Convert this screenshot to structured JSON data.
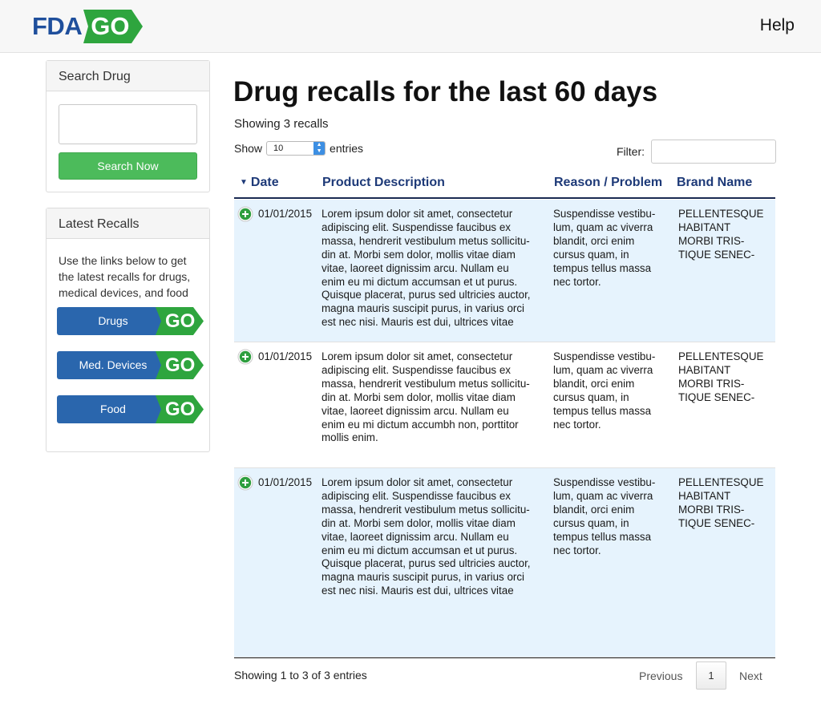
{
  "header": {
    "logo_fda": "FDA",
    "logo_go": "GO",
    "help_label": "Help",
    "brand_blue": "#1f4f9c",
    "brand_green": "#2ea53e"
  },
  "sidebar": {
    "search": {
      "title": "Search Drug",
      "input_value": "",
      "button_label": "Search Now"
    },
    "latest": {
      "title": "Latest Recalls",
      "intro": "Use the links below to get the latest recalls for drugs, medical devices, and food",
      "go_label": "GO",
      "links": [
        {
          "label": "Drugs"
        },
        {
          "label": "Med. Devices"
        },
        {
          "label": "Food"
        }
      ]
    }
  },
  "main": {
    "title": "Drug recalls for the last 60 days",
    "count_text": "Showing 3 recalls",
    "length": {
      "prefix": "Show",
      "value": "10",
      "suffix": "entries"
    },
    "filter_label": "Filter:",
    "filter_value": "",
    "columns": {
      "date": "Date",
      "description": "Product Description",
      "reason": "Reason / Problem",
      "brand": "Brand Name"
    },
    "rows": [
      {
        "date": "01/01/2015",
        "description": [
          "Lorem ipsum dolor sit amet, consectetur",
          "adipiscing elit. Suspendisse faucibus ex",
          "massa, hendrerit vestibulum metus sollicitu-",
          "din at. Morbi sem dolor, mollis vitae diam",
          "vitae, laoreet dignissim arcu. Nullam eu",
          "enim eu mi dictum accumsan et ut purus.",
          "Quisque placerat, purus sed ultricies auctor,",
          "magna mauris suscipit purus, in varius orci",
          "est nec nisi. Mauris est dui, ultrices vitae"
        ],
        "reason": [
          "Suspendisse vestibu-",
          "lum, quam ac viverra",
          "blandit, orci enim",
          "cursus quam, in",
          "tempus tellus massa",
          "nec tortor."
        ],
        "brand": [
          "PELLENTESQUE",
          "HABITANT",
          "MORBI TRIS-",
          "TIQUE SENEC-"
        ]
      },
      {
        "date": "01/01/2015",
        "description": [
          "Lorem ipsum dolor sit amet, consectetur",
          "adipiscing elit. Suspendisse faucibus ex",
          "massa, hendrerit vestibulum metus sollicitu-",
          "din at. Morbi sem dolor, mollis vitae diam",
          "vitae, laoreet dignissim arcu. Nullam eu",
          "enim eu mi dictum accumbh non, porttitor",
          "mollis enim."
        ],
        "reason": [
          "Suspendisse vestibu-",
          "lum, quam ac viverra",
          "blandit, orci enim",
          "cursus quam, in",
          "tempus tellus massa",
          "nec tortor."
        ],
        "brand": [
          "PELLENTESQUE",
          "HABITANT",
          "MORBI TRIS-",
          "TIQUE SENEC-"
        ]
      },
      {
        "date": "01/01/2015",
        "description": [
          "Lorem ipsum dolor sit amet, consectetur",
          "adipiscing elit. Suspendisse faucibus ex",
          "massa, hendrerit vestibulum metus sollicitu-",
          "din at. Morbi sem dolor, mollis vitae diam",
          "vitae, laoreet dignissim arcu. Nullam eu",
          "enim eu mi dictum accumsan et ut purus.",
          "Quisque placerat, purus sed ultricies auctor,",
          "magna mauris suscipit purus, in varius orci",
          "est nec nisi. Mauris est dui, ultrices vitae"
        ],
        "reason": [
          "Suspendisse vestibu-",
          "lum, quam ac viverra",
          "blandit, orci enim",
          "cursus quam, in",
          "tempus tellus massa",
          "nec tortor."
        ],
        "brand": [
          "PELLENTESQUE",
          "HABITANT",
          "MORBI TRIS-",
          "TIQUE SENEC-"
        ]
      }
    ],
    "info_text": "Showing 1 to 3 of 3 entries",
    "pager": {
      "previous": "Previous",
      "page": "1",
      "next": "Next"
    }
  }
}
